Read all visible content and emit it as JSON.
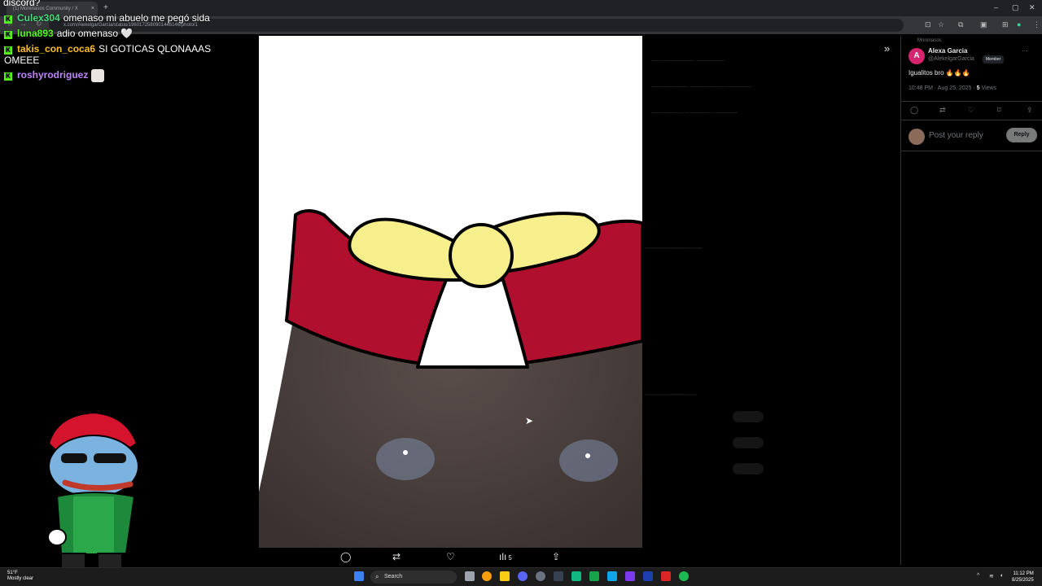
{
  "browser": {
    "tab_title": "(1) Morenasos Community / X",
    "url": "x.com/AlekelgarGarcia/status/1960172580901446146/photo/1"
  },
  "chat": {
    "top_line": "discord?",
    "messages": [
      {
        "user": "Culex304",
        "text": "omenaso mi abuelo me pegó sida",
        "color": "#4ade80"
      },
      {
        "user": "luna893",
        "text": "adio omenaso 🤍",
        "color": "#53fc18"
      },
      {
        "user": "takis_con_coca6",
        "text": "SI GOTICAS QLONAAAS OMEEE",
        "color": "#fbbf24"
      },
      {
        "user": "roshyrodriguez",
        "text": "",
        "color": "#c084fc"
      }
    ]
  },
  "photo_actions": {
    "views_count": "5"
  },
  "tweet": {
    "community": "Morenasos",
    "avatar_letter": "A",
    "name": "Alexa Garcia",
    "handle": "@AlekelgarGarcia",
    "member_badge": "Member",
    "text": "Igualitos bro 🔥🔥🔥",
    "time": "10:48 PM · Aug 25, 2025 · ",
    "views_num": "5",
    "views_label": " Views",
    "reply_placeholder": "Post your reply",
    "reply_button": "Reply"
  },
  "taskbar": {
    "temperature": "51°F",
    "weather": "Mostly clear",
    "search_label": "Search",
    "time": "11:12 PM",
    "date": "8/25/2025"
  },
  "colors": {
    "kick_green": "#53fc18",
    "x_pink": "#d6246e",
    "hat_red": "#b0102e",
    "hat_yellow": "#f7ee8c"
  },
  "icons": [
    "comment-icon",
    "repost-icon",
    "like-icon",
    "views-icon",
    "share-icon",
    "bookmark-icon",
    "expand-icon",
    "windows-start-icon",
    "search-icon"
  ]
}
